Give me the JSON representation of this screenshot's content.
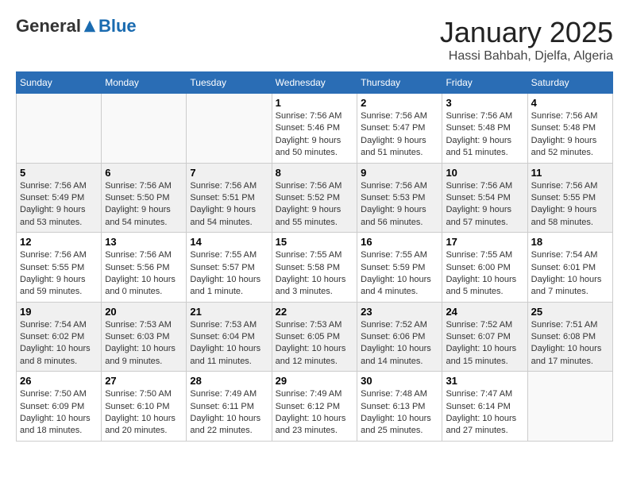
{
  "header": {
    "logo_general": "General",
    "logo_blue": "Blue",
    "month_title": "January 2025",
    "location": "Hassi Bahbah, Djelfa, Algeria"
  },
  "weekdays": [
    "Sunday",
    "Monday",
    "Tuesday",
    "Wednesday",
    "Thursday",
    "Friday",
    "Saturday"
  ],
  "weeks": [
    [
      {
        "day": "",
        "sunrise": "",
        "sunset": "",
        "daylight": ""
      },
      {
        "day": "",
        "sunrise": "",
        "sunset": "",
        "daylight": ""
      },
      {
        "day": "",
        "sunrise": "",
        "sunset": "",
        "daylight": ""
      },
      {
        "day": "1",
        "sunrise": "Sunrise: 7:56 AM",
        "sunset": "Sunset: 5:46 PM",
        "daylight": "Daylight: 9 hours and 50 minutes."
      },
      {
        "day": "2",
        "sunrise": "Sunrise: 7:56 AM",
        "sunset": "Sunset: 5:47 PM",
        "daylight": "Daylight: 9 hours and 51 minutes."
      },
      {
        "day": "3",
        "sunrise": "Sunrise: 7:56 AM",
        "sunset": "Sunset: 5:48 PM",
        "daylight": "Daylight: 9 hours and 51 minutes."
      },
      {
        "day": "4",
        "sunrise": "Sunrise: 7:56 AM",
        "sunset": "Sunset: 5:48 PM",
        "daylight": "Daylight: 9 hours and 52 minutes."
      }
    ],
    [
      {
        "day": "5",
        "sunrise": "Sunrise: 7:56 AM",
        "sunset": "Sunset: 5:49 PM",
        "daylight": "Daylight: 9 hours and 53 minutes."
      },
      {
        "day": "6",
        "sunrise": "Sunrise: 7:56 AM",
        "sunset": "Sunset: 5:50 PM",
        "daylight": "Daylight: 9 hours and 54 minutes."
      },
      {
        "day": "7",
        "sunrise": "Sunrise: 7:56 AM",
        "sunset": "Sunset: 5:51 PM",
        "daylight": "Daylight: 9 hours and 54 minutes."
      },
      {
        "day": "8",
        "sunrise": "Sunrise: 7:56 AM",
        "sunset": "Sunset: 5:52 PM",
        "daylight": "Daylight: 9 hours and 55 minutes."
      },
      {
        "day": "9",
        "sunrise": "Sunrise: 7:56 AM",
        "sunset": "Sunset: 5:53 PM",
        "daylight": "Daylight: 9 hours and 56 minutes."
      },
      {
        "day": "10",
        "sunrise": "Sunrise: 7:56 AM",
        "sunset": "Sunset: 5:54 PM",
        "daylight": "Daylight: 9 hours and 57 minutes."
      },
      {
        "day": "11",
        "sunrise": "Sunrise: 7:56 AM",
        "sunset": "Sunset: 5:55 PM",
        "daylight": "Daylight: 9 hours and 58 minutes."
      }
    ],
    [
      {
        "day": "12",
        "sunrise": "Sunrise: 7:56 AM",
        "sunset": "Sunset: 5:55 PM",
        "daylight": "Daylight: 9 hours and 59 minutes."
      },
      {
        "day": "13",
        "sunrise": "Sunrise: 7:56 AM",
        "sunset": "Sunset: 5:56 PM",
        "daylight": "Daylight: 10 hours and 0 minutes."
      },
      {
        "day": "14",
        "sunrise": "Sunrise: 7:55 AM",
        "sunset": "Sunset: 5:57 PM",
        "daylight": "Daylight: 10 hours and 1 minute."
      },
      {
        "day": "15",
        "sunrise": "Sunrise: 7:55 AM",
        "sunset": "Sunset: 5:58 PM",
        "daylight": "Daylight: 10 hours and 3 minutes."
      },
      {
        "day": "16",
        "sunrise": "Sunrise: 7:55 AM",
        "sunset": "Sunset: 5:59 PM",
        "daylight": "Daylight: 10 hours and 4 minutes."
      },
      {
        "day": "17",
        "sunrise": "Sunrise: 7:55 AM",
        "sunset": "Sunset: 6:00 PM",
        "daylight": "Daylight: 10 hours and 5 minutes."
      },
      {
        "day": "18",
        "sunrise": "Sunrise: 7:54 AM",
        "sunset": "Sunset: 6:01 PM",
        "daylight": "Daylight: 10 hours and 7 minutes."
      }
    ],
    [
      {
        "day": "19",
        "sunrise": "Sunrise: 7:54 AM",
        "sunset": "Sunset: 6:02 PM",
        "daylight": "Daylight: 10 hours and 8 minutes."
      },
      {
        "day": "20",
        "sunrise": "Sunrise: 7:53 AM",
        "sunset": "Sunset: 6:03 PM",
        "daylight": "Daylight: 10 hours and 9 minutes."
      },
      {
        "day": "21",
        "sunrise": "Sunrise: 7:53 AM",
        "sunset": "Sunset: 6:04 PM",
        "daylight": "Daylight: 10 hours and 11 minutes."
      },
      {
        "day": "22",
        "sunrise": "Sunrise: 7:53 AM",
        "sunset": "Sunset: 6:05 PM",
        "daylight": "Daylight: 10 hours and 12 minutes."
      },
      {
        "day": "23",
        "sunrise": "Sunrise: 7:52 AM",
        "sunset": "Sunset: 6:06 PM",
        "daylight": "Daylight: 10 hours and 14 minutes."
      },
      {
        "day": "24",
        "sunrise": "Sunrise: 7:52 AM",
        "sunset": "Sunset: 6:07 PM",
        "daylight": "Daylight: 10 hours and 15 minutes."
      },
      {
        "day": "25",
        "sunrise": "Sunrise: 7:51 AM",
        "sunset": "Sunset: 6:08 PM",
        "daylight": "Daylight: 10 hours and 17 minutes."
      }
    ],
    [
      {
        "day": "26",
        "sunrise": "Sunrise: 7:50 AM",
        "sunset": "Sunset: 6:09 PM",
        "daylight": "Daylight: 10 hours and 18 minutes."
      },
      {
        "day": "27",
        "sunrise": "Sunrise: 7:50 AM",
        "sunset": "Sunset: 6:10 PM",
        "daylight": "Daylight: 10 hours and 20 minutes."
      },
      {
        "day": "28",
        "sunrise": "Sunrise: 7:49 AM",
        "sunset": "Sunset: 6:11 PM",
        "daylight": "Daylight: 10 hours and 22 minutes."
      },
      {
        "day": "29",
        "sunrise": "Sunrise: 7:49 AM",
        "sunset": "Sunset: 6:12 PM",
        "daylight": "Daylight: 10 hours and 23 minutes."
      },
      {
        "day": "30",
        "sunrise": "Sunrise: 7:48 AM",
        "sunset": "Sunset: 6:13 PM",
        "daylight": "Daylight: 10 hours and 25 minutes."
      },
      {
        "day": "31",
        "sunrise": "Sunrise: 7:47 AM",
        "sunset": "Sunset: 6:14 PM",
        "daylight": "Daylight: 10 hours and 27 minutes."
      },
      {
        "day": "",
        "sunrise": "",
        "sunset": "",
        "daylight": ""
      }
    ]
  ]
}
